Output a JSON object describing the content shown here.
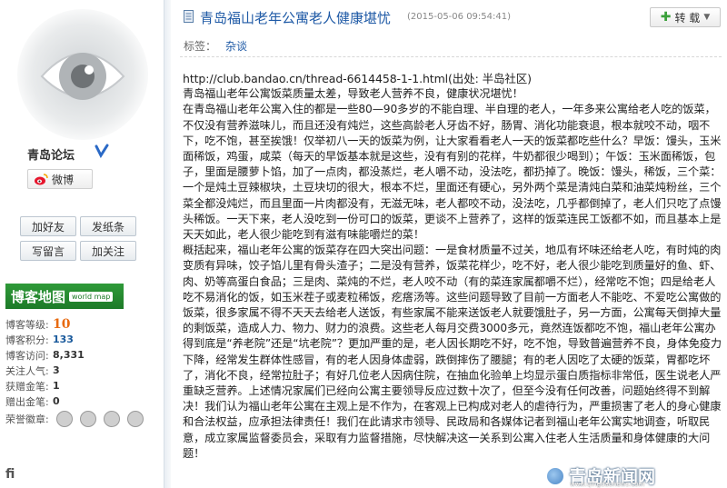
{
  "sidebar": {
    "nickname": "青岛论坛",
    "weibo_label": "微博",
    "buttons": {
      "add_friend": "加好友",
      "send_note": "发纸条",
      "leave_message": "写留言",
      "follow": "加关注"
    },
    "map_banner": {
      "title": "博客地图",
      "sub": "world map"
    },
    "stats": {
      "level_label": "博客等级:",
      "level_value": "10",
      "points_label": "博客积分:",
      "points_value": "133",
      "visits_label": "博客访问:",
      "visits_value": "8,331",
      "fans_label": "关注人气:",
      "fans_value": "3",
      "gift_gold_label": "获赠金笔:",
      "gift_gold_value": "1",
      "given_gold_label": "赠出金笔:",
      "given_gold_value": "0",
      "medals_label": "荣誉徽章:"
    },
    "footer_text": "fi"
  },
  "post": {
    "title": "青岛福山老年公寓老人健康堪忧",
    "date": "(2015-05-06 09:54:41)",
    "repost_label": "转 载",
    "tag_label": "标签：",
    "tag_value": "杂谈",
    "source_line": "http://club.bandao.cn/thread-6614458-1-1.html(出处: 半岛社区)",
    "paragraphs": [
      "青岛福山老年公寓饭菜质量太差，导致老人营养不良，健康状况堪忧！",
      "在青岛福山老年公寓入住的都是一些80—90多岁的不能自理、半自理的老人，一年多来公寓给老人吃的饭菜，不仅没有营养滋味儿，而且还没有炖烂，这些高龄老人牙齿不好，肠胃、消化功能衰退，根本就咬不动，咽不下，吃不饱，甚至挨饿！仅举初八一天的饭菜为例，让大家看看老人一天的饭菜都吃些什么？早饭：馒头，玉米面稀饭，鸡蛋，咸菜（每天的早饭基本就是这些，没有有别的花样，牛奶都很少喝到）；午饭：玉米面稀饭，包子，里面是腰萝卜馅，加了一点肉，都没蒸烂，老人嚼不动，没法吃，都扔掉了。晚饭：馒头，稀饭，三个菜：一个是炖土豆辣椒块，土豆块切的很大，根本不烂，里面还有硬心，另外两个菜是清炖白菜和油菜炖粉丝，三个菜全都没炖烂，而且里面一片肉都没有，无滋无味，老人都咬不动，没法吃，几乎都倒掉了，老人们只吃了点馒头稀饭。一天下来，老人没吃到一份可口的饭菜，更谈不上营养了，这样的饭菜连民工饭都不如，而且基本上是天天如此，老人很少能吃到有滋有味能嚼烂的菜！",
      "概括起来，福山老年公寓的饭菜存在四大突出问题：一是食材质量不过关，地瓜有坏味还给老人吃，有时炖的肉变质有异味，饺子馅儿里有骨头渣子；二是没有营养，饭菜花样少，吃不好，老人很少能吃到质量好的鱼、虾、肉、奶等高蛋白食品；三是肉、菜炖的不烂，老人咬不动（有的菜连家属都嚼不烂），经常吃不饱；四是给老人吃不易消化的饭，如玉米茬子或麦粒稀饭，疙瘩汤等。这些问题导致了目前一方面老人不能吃、不爱吃公寓做的饭菜，很多家属不得不天天去给老人送饭，有些家属不能来送饭老人就要饿肚子，另一方面，公寓每天倒掉大量的剩饭菜，造成人力、物力、财力的浪费。这些老人每月交费3000多元，竟然连饭都吃不饱，福山老年公寓办得到底是“养老院”还是“坑老院”？更加严重的是，老人因长期吃不好，吃不饱，导致普遍营养不良，身体免疫力下降，经常发生群体性感冒，有的老人因身体虚弱，跌倒摔伤了腰腿；有的老人因吃了太硬的饭菜，胃都吃坏了，消化不良，经常拉肚子；有好几位老人因病住院，在抽血化验单上均显示蛋白质指标非常低，医生说老人严重缺乏营养。上述情况家属们已经向公寓主要领导反应过数十次了，但至今没有任何改善，问题始终得不到解决！我们认为福山老年公寓在主观上是不作为，在客观上已构成对老人的虐待行为，严重损害了老人的身心健康和合法权益，应承担法律责任！我们在此请求市领导、民政局和各媒体记者到福山老年公寓实地调查，听取民意，成立家属监督委员会，采取有力监督措施，尽快解决这一关系到公寓入住老人生活质量和身体健康的大问题！"
    ]
  },
  "watermark": {
    "text": "青岛新闻网",
    "url": "www.qingdaonews.com"
  },
  "colors": {
    "link_blue": "#1f5aa6",
    "map_green": "#1d7a28",
    "level_orange": "#e86a10"
  },
  "icons": [
    "sina-weibo-eye-avatar",
    "verified-v-icon",
    "weibo-icon",
    "document-icon",
    "plus-icon",
    "medal-icon"
  ]
}
